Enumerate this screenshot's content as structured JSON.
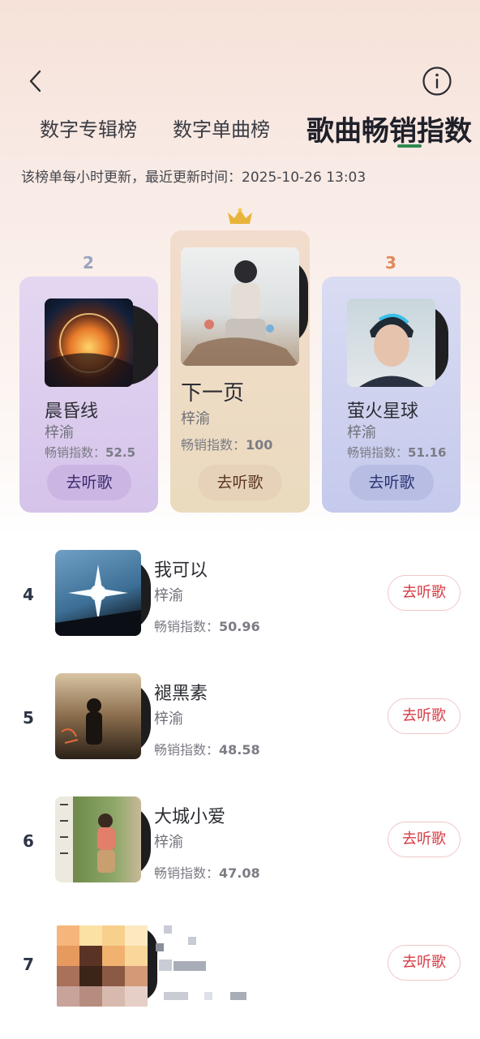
{
  "header": {
    "back_icon": "chevron-left-icon",
    "info_icon": "info-circle-icon",
    "tabs": [
      {
        "label": "数字专辑榜"
      },
      {
        "label": "数字单曲榜"
      },
      {
        "label": "歌曲畅销指数"
      }
    ],
    "update_note": "该榜单每小时更新，最近更新时间：2025-10-26 13:03"
  },
  "podium": {
    "crown_icon": "crown-icon",
    "first": {
      "rank": "1",
      "title": "下一页",
      "artist": "梓渝",
      "index_label": "畅销指数：",
      "index_value": "100",
      "button": "去听歌",
      "color": "#e9d8c3"
    },
    "second": {
      "rank": "2",
      "title": "晨昏线",
      "artist": "梓渝",
      "index_label": "畅销指数：",
      "index_value": "52.5",
      "button": "去听歌",
      "color": "#d8c6ec"
    },
    "third": {
      "rank": "3",
      "title": "萤火星球",
      "artist": "梓渝",
      "index_label": "畅销指数：",
      "index_value": "51.16",
      "button": "去听歌",
      "color": "#c7cdeb"
    }
  },
  "list": [
    {
      "rank": "4",
      "title": "我可以",
      "artist": "梓渝",
      "index_label": "畅销指数：",
      "index_value": "50.96",
      "button": "去听歌"
    },
    {
      "rank": "5",
      "title": "褪黑素",
      "artist": "梓渝",
      "index_label": "畅销指数：",
      "index_value": "48.58",
      "button": "去听歌"
    },
    {
      "rank": "6",
      "title": "大城小爱",
      "artist": "梓渝",
      "index_label": "畅销指数：",
      "index_value": "47.08",
      "button": "去听歌"
    },
    {
      "rank": "7",
      "button": "去听歌"
    }
  ],
  "colors": {
    "accent_red": "#d83b45",
    "rank2": "#9aa3bd",
    "rank3": "#e08a5a",
    "underline": "#2f8a4f"
  }
}
